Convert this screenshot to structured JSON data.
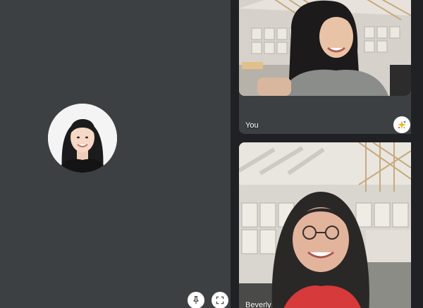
{
  "main": {
    "participant_avatar": "avatar-photo",
    "controls": {
      "pin_icon": "pin-icon",
      "fullscreen_icon": "fullscreen-icon"
    }
  },
  "side_tiles": [
    {
      "name": "You",
      "effects_icon": "sparkle-effects-icon"
    },
    {
      "name": "Beverly"
    }
  ],
  "colors": {
    "background": "#202124",
    "tile": "#3c4043",
    "label": "#ffffff"
  }
}
